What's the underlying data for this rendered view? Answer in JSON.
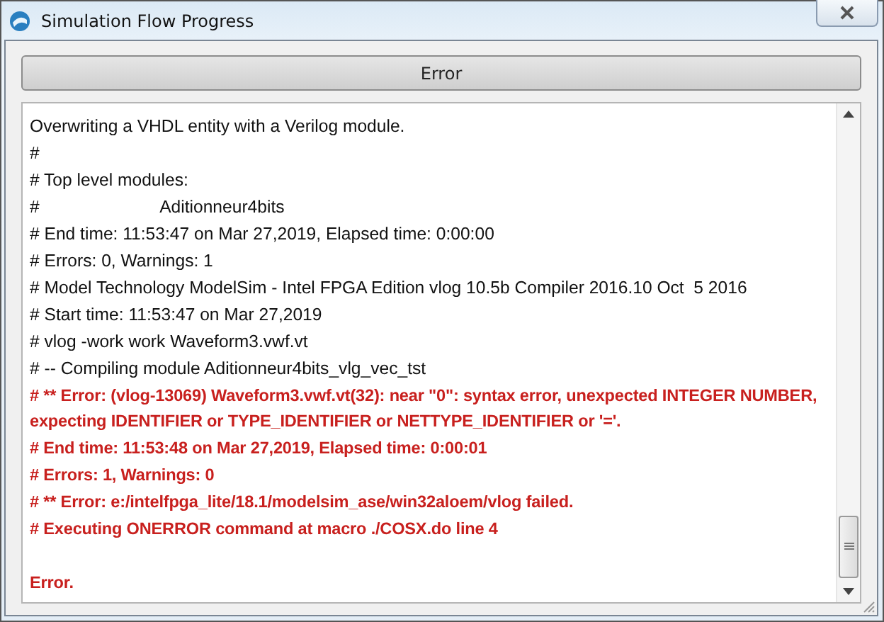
{
  "window": {
    "title": "Simulation Flow Progress"
  },
  "status_button": {
    "label": "Error"
  },
  "log": [
    {
      "text": "Overwriting a VHDL entity with a Verilog module.",
      "kind": "info"
    },
    {
      "text": "#",
      "kind": "info"
    },
    {
      "text": "# Top level modules:",
      "kind": "info"
    },
    {
      "text": "#                         Aditionneur4bits",
      "kind": "info"
    },
    {
      "text": "# End time: 11:53:47 on Mar 27,2019, Elapsed time: 0:00:00",
      "kind": "info"
    },
    {
      "text": "# Errors: 0, Warnings: 1",
      "kind": "info"
    },
    {
      "text": "# Model Technology ModelSim - Intel FPGA Edition vlog 10.5b Compiler 2016.10 Oct  5 2016",
      "kind": "info"
    },
    {
      "text": "# Start time: 11:53:47 on Mar 27,2019",
      "kind": "info"
    },
    {
      "text": "# vlog -work work Waveform3.vwf.vt",
      "kind": "info"
    },
    {
      "text": "# -- Compiling module Aditionneur4bits_vlg_vec_tst",
      "kind": "info"
    },
    {
      "text": "# ** Error: (vlog-13069) Waveform3.vwf.vt(32): near \"0\": syntax error, unexpected INTEGER NUMBER,",
      "kind": "error"
    },
    {
      "text": "expecting IDENTIFIER or TYPE_IDENTIFIER or NETTYPE_IDENTIFIER or '='.",
      "kind": "error"
    },
    {
      "text": "# End time: 11:53:48 on Mar 27,2019, Elapsed time: 0:00:01",
      "kind": "error"
    },
    {
      "text": "# Errors: 1, Warnings: 0",
      "kind": "error"
    },
    {
      "text": "# ** Error: e:/intelfpga_lite/18.1/modelsim_ase/win32aloem/vlog failed.",
      "kind": "error"
    },
    {
      "text": "# Executing ONERROR command at macro ./COSX.do line 4",
      "kind": "error"
    },
    {
      "text": "Error.",
      "kind": "error",
      "space_before": true
    }
  ]
}
